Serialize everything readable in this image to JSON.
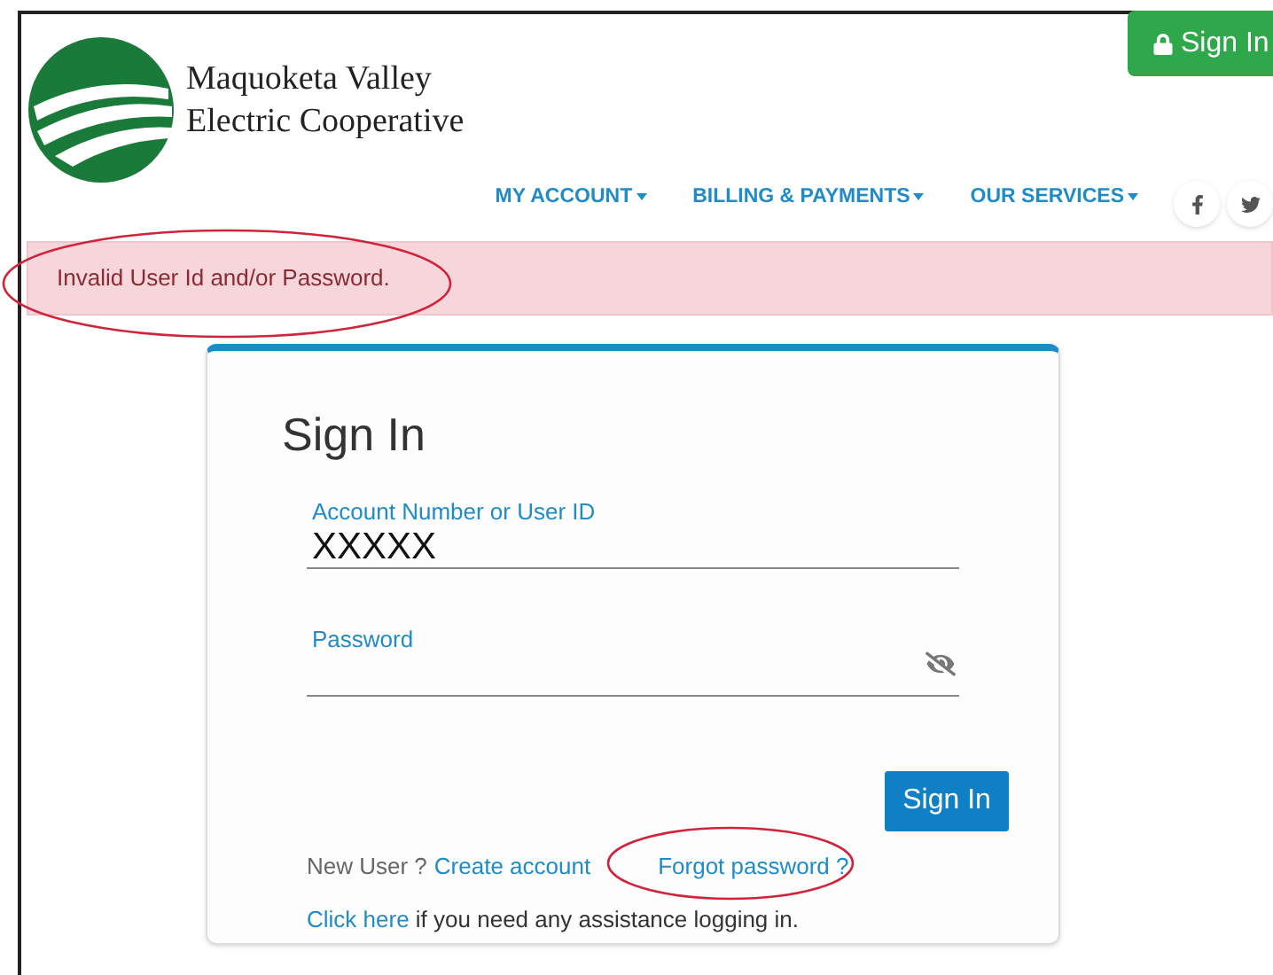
{
  "logo": {
    "lines": [
      "Maquoketa Valley",
      "Electric Cooperative"
    ]
  },
  "header_button": "Sign In",
  "nav": [
    {
      "label": "MY ACCOUNT"
    },
    {
      "label": "BILLING & PAYMENTS"
    },
    {
      "label": "OUR SERVICES"
    }
  ],
  "alert": "Invalid User Id and/or Password.",
  "card": {
    "title": "Sign In",
    "fields": [
      {
        "label": "Account Number or User ID",
        "value": "XXXXX",
        "kind": "text"
      },
      {
        "label": "Password",
        "kind": "password"
      }
    ],
    "submit": "Sign In",
    "new_user": "New User ?",
    "create_link": "Create account",
    "forgot_link": "Forgot password ?",
    "help_link": "Click here",
    "help_text": "if you need any assistance logging in."
  }
}
